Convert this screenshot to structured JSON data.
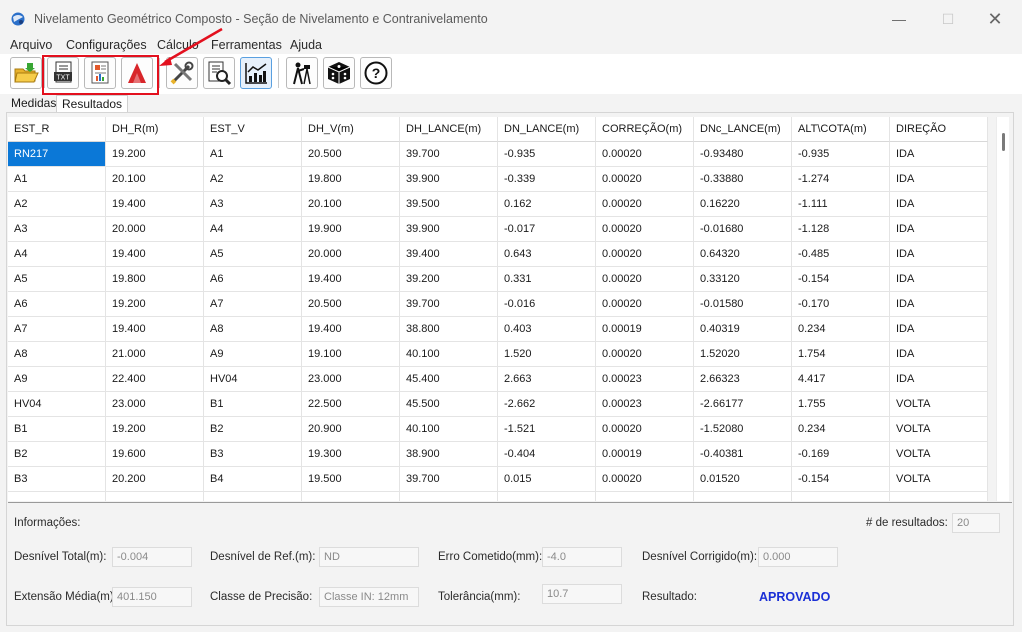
{
  "window": {
    "title": "Nivelamento Geométrico Composto - Seção de Nivelamento e Contranivelamento",
    "minimize": "—",
    "maximize": "☐",
    "close": "✕"
  },
  "menu": [
    "Arquivo",
    "Configurações",
    "Cálculo",
    "Ferramentas",
    "Ajuda"
  ],
  "toolbar": {
    "buttons": [
      {
        "name": "open-folder-icon"
      },
      {
        "name": "export-txt-icon",
        "label": "TXT"
      },
      {
        "name": "report-icon"
      },
      {
        "name": "autocad-icon"
      },
      {
        "name": "tools-icon"
      },
      {
        "name": "search-document-icon"
      },
      {
        "name": "chart-icon"
      },
      {
        "name": "surveyor-icon"
      },
      {
        "name": "dice-icon"
      },
      {
        "name": "help-icon",
        "label": "?"
      }
    ],
    "highlight_color": "#e3101e"
  },
  "tabs": [
    {
      "label": "Medidas",
      "active": false
    },
    {
      "label": "Resultados",
      "active": true
    }
  ],
  "table": {
    "columns": [
      "EST_R",
      "DH_R(m)",
      "EST_V",
      "DH_V(m)",
      "DH_LANCE(m)",
      "DN_LANCE(m)",
      "CORREÇÃO(m)",
      "DNc_LANCE(m)",
      "ALT\\COTA(m)",
      "DIREÇÃO"
    ],
    "rows": [
      [
        "RN217",
        "19.200",
        "A1",
        "20.500",
        "39.700",
        "-0.935",
        "0.00020",
        "-0.93480",
        "-0.935",
        "IDA"
      ],
      [
        "A1",
        "20.100",
        "A2",
        "19.800",
        "39.900",
        "-0.339",
        "0.00020",
        "-0.33880",
        "-1.274",
        "IDA"
      ],
      [
        "A2",
        "19.400",
        "A3",
        "20.100",
        "39.500",
        "0.162",
        "0.00020",
        "0.16220",
        "-1.111",
        "IDA"
      ],
      [
        "A3",
        "20.000",
        "A4",
        "19.900",
        "39.900",
        "-0.017",
        "0.00020",
        "-0.01680",
        "-1.128",
        "IDA"
      ],
      [
        "A4",
        "19.400",
        "A5",
        "20.000",
        "39.400",
        "0.643",
        "0.00020",
        "0.64320",
        "-0.485",
        "IDA"
      ],
      [
        "A5",
        "19.800",
        "A6",
        "19.400",
        "39.200",
        "0.331",
        "0.00020",
        "0.33120",
        "-0.154",
        "IDA"
      ],
      [
        "A6",
        "19.200",
        "A7",
        "20.500",
        "39.700",
        "-0.016",
        "0.00020",
        "-0.01580",
        "-0.170",
        "IDA"
      ],
      [
        "A7",
        "19.400",
        "A8",
        "19.400",
        "38.800",
        "0.403",
        "0.00019",
        "0.40319",
        "0.234",
        "IDA"
      ],
      [
        "A8",
        "21.000",
        "A9",
        "19.100",
        "40.100",
        "1.520",
        "0.00020",
        "1.52020",
        "1.754",
        "IDA"
      ],
      [
        "A9",
        "22.400",
        "HV04",
        "23.000",
        "45.400",
        "2.663",
        "0.00023",
        "2.66323",
        "4.417",
        "IDA"
      ],
      [
        "HV04",
        "23.000",
        "B1",
        "22.500",
        "45.500",
        "-2.662",
        "0.00023",
        "-2.66177",
        "1.755",
        "VOLTA"
      ],
      [
        "B1",
        "19.200",
        "B2",
        "20.900",
        "40.100",
        "-1.521",
        "0.00020",
        "-1.52080",
        "0.234",
        "VOLTA"
      ],
      [
        "B2",
        "19.600",
        "B3",
        "19.300",
        "38.900",
        "-0.404",
        "0.00019",
        "-0.40381",
        "-0.169",
        "VOLTA"
      ],
      [
        "B3",
        "20.200",
        "B4",
        "19.500",
        "39.700",
        "0.015",
        "0.00020",
        "0.01520",
        "-0.154",
        "VOLTA"
      ]
    ],
    "selected_cell": "RN217",
    "selected_color": "#0b78d7"
  },
  "info": {
    "title": "Informações:",
    "results_count_label": "# de resultados:",
    "results_count": "20",
    "desnivel_total_label": "Desnível Total(m):",
    "desnivel_total": "-0.004",
    "desnivel_ref_label": "Desnível de Ref.(m):",
    "desnivel_ref": "ND",
    "erro_cometido_label": "Erro Cometido(mm):",
    "erro_cometido": "-4.0",
    "desnivel_corrigido_label": "Desnível Corrigido(m):",
    "desnivel_corrigido": "0.000",
    "extensao_media_label": "Extensão Média(m):",
    "extensao_media": "401.150",
    "classe_precisao_label": "Classe de Precisão:",
    "classe_precisao": "Classe IN: 12mm",
    "tolerancia_label": "Tolerância(mm):",
    "tolerancia": "10.7",
    "resultado_label": "Resultado:",
    "resultado": "APROVADO",
    "resultado_color": "#1a2fd6"
  }
}
